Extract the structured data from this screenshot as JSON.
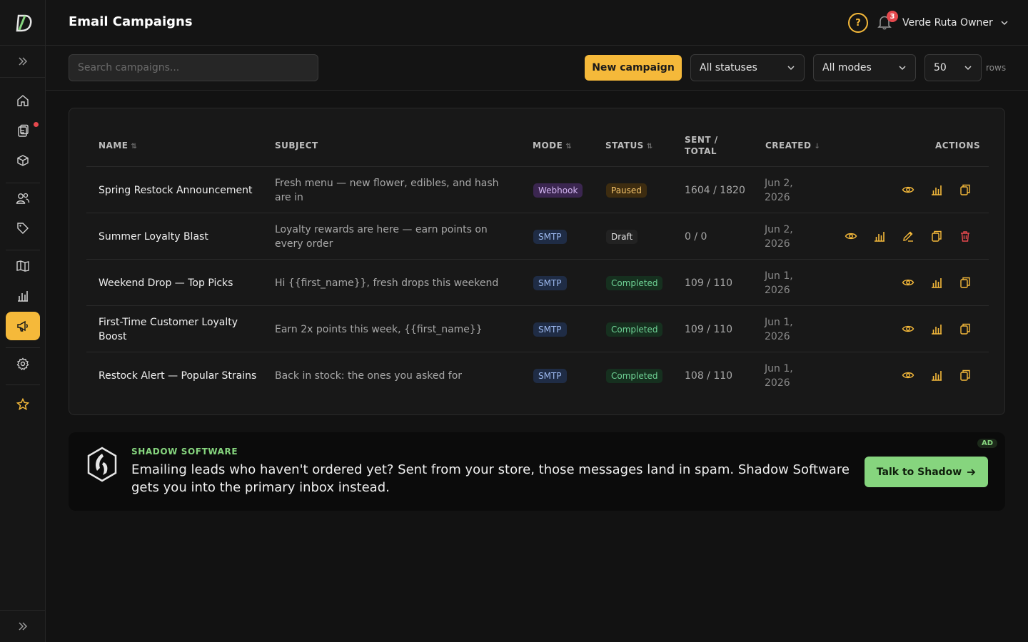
{
  "header": {
    "title": "Email Campaigns",
    "help_icon": "?",
    "notifications_count": "3",
    "user_name": "Verde Ruta Owner"
  },
  "sidebar": {
    "items": [
      {
        "name": "home-icon"
      },
      {
        "name": "orders-icon",
        "has_dot": true
      },
      {
        "name": "inventory-icon"
      },
      {
        "name": "customers-icon"
      },
      {
        "name": "tag-icon"
      },
      {
        "name": "book-icon"
      },
      {
        "name": "analytics-icon"
      },
      {
        "name": "megaphone-icon",
        "active": true
      },
      {
        "name": "settings-icon"
      },
      {
        "name": "star-icon"
      }
    ]
  },
  "toolbar": {
    "search_placeholder": "Search campaigns...",
    "new_campaign": "New campaign",
    "status_filter": "All statuses",
    "mode_filter": "All modes",
    "rows_value": "50",
    "rows_label": "rows"
  },
  "table": {
    "headers": {
      "name": "NAME",
      "subject": "SUBJECT",
      "mode": "MODE",
      "status": "STATUS",
      "sent_total_1": "SENT /",
      "sent_total_2": "TOTAL",
      "created": "CREATED",
      "actions": "ACTIONS"
    },
    "rows": [
      {
        "name": "Spring Restock Announcement",
        "subject": "Fresh menu — new flower, edibles, and hash are in",
        "mode": "Webhook",
        "status": "Paused",
        "sent": "1604 / 1820",
        "created": "Jun 2, 2026"
      },
      {
        "name": "Summer Loyalty Blast",
        "subject": "Loyalty rewards are here — earn points on every order",
        "mode": "SMTP",
        "status": "Draft",
        "sent": "0 / 0",
        "created": "Jun 2, 2026"
      },
      {
        "name": "Weekend Drop — Top Picks",
        "subject": "Hi {{first_name}}, fresh drops this weekend",
        "mode": "SMTP",
        "status": "Completed",
        "sent": "109 / 110",
        "created": "Jun 1, 2026"
      },
      {
        "name": "First-Time Customer Loyalty Boost",
        "subject": "Earn 2x points this week, {{first_name}}",
        "mode": "SMTP",
        "status": "Completed",
        "sent": "109 / 110",
        "created": "Jun 1, 2026"
      },
      {
        "name": "Restock Alert — Popular Strains",
        "subject": "Back in stock: the ones you asked for",
        "mode": "SMTP",
        "status": "Completed",
        "sent": "108 / 110",
        "created": "Jun 1, 2026"
      }
    ]
  },
  "ad": {
    "brand": "SHADOW SOFTWARE",
    "text": "Emailing leads who haven't ordered yet? Sent from your store, those messages land in spam. Shadow Software gets you into the primary inbox instead.",
    "button": "Talk to Shadow",
    "tag": "AD"
  },
  "colors": {
    "accent": "#f5b93a",
    "danger": "#e5484d",
    "ad_green": "#86d57e"
  }
}
